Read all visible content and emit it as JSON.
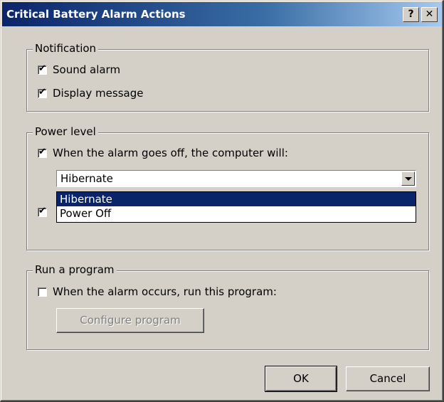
{
  "window": {
    "title": "Critical Battery Alarm Actions",
    "help_glyph": "?",
    "close_glyph": "✕"
  },
  "notification": {
    "legend": "Notification",
    "sound_alarm": {
      "label": "Sound alarm",
      "checked": true
    },
    "display_message": {
      "label": "Display message",
      "checked": true
    }
  },
  "power_level": {
    "legend": "Power level",
    "when_alarm": {
      "label": "When the alarm goes off, the computer will:",
      "checked": true
    },
    "combo_value": "Hibernate",
    "options": [
      "Hibernate",
      "Power Off"
    ],
    "selected_option": "Hibernate",
    "obscured_checkbox_checked": true
  },
  "run_program": {
    "legend": "Run a program",
    "when_occurs": {
      "label": "When the alarm occurs, run this program:",
      "checked": false
    },
    "configure_button": "Configure program"
  },
  "buttons": {
    "ok": "OK",
    "cancel": "Cancel"
  }
}
